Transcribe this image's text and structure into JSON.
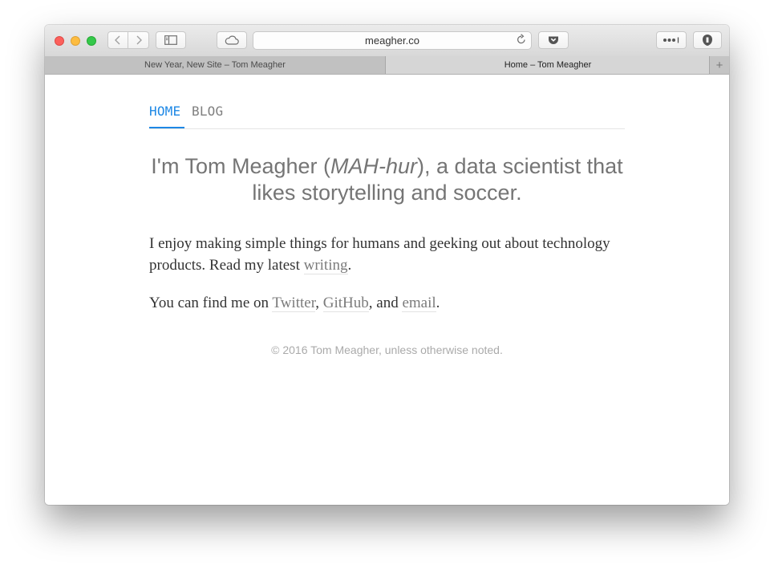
{
  "browser": {
    "address": "meagher.co",
    "tabs": [
      {
        "label": "New Year, New Site – Tom Meagher"
      },
      {
        "label": "Home – Tom Meagher"
      }
    ],
    "new_tab": "+"
  },
  "nav": {
    "home": "HOME",
    "blog": "BLOG",
    "accent": "#1e88e5"
  },
  "headline": {
    "pre": "I'm Tom Meagher (",
    "pronunciation": "MAH-hur",
    "post": "), a data scientist that likes storytelling and soccer."
  },
  "intro": {
    "text": "I enjoy making simple things for humans and geeking out about technology products. Read my latest ",
    "link": "writing",
    "end": "."
  },
  "contact": {
    "text": "You can find me on ",
    "twitter": "Twitter",
    "sep1": ", ",
    "github": "GitHub",
    "sep2": ", and ",
    "email": "email",
    "end": "."
  },
  "footer": "© 2016 Tom Meagher, unless otherwise noted."
}
